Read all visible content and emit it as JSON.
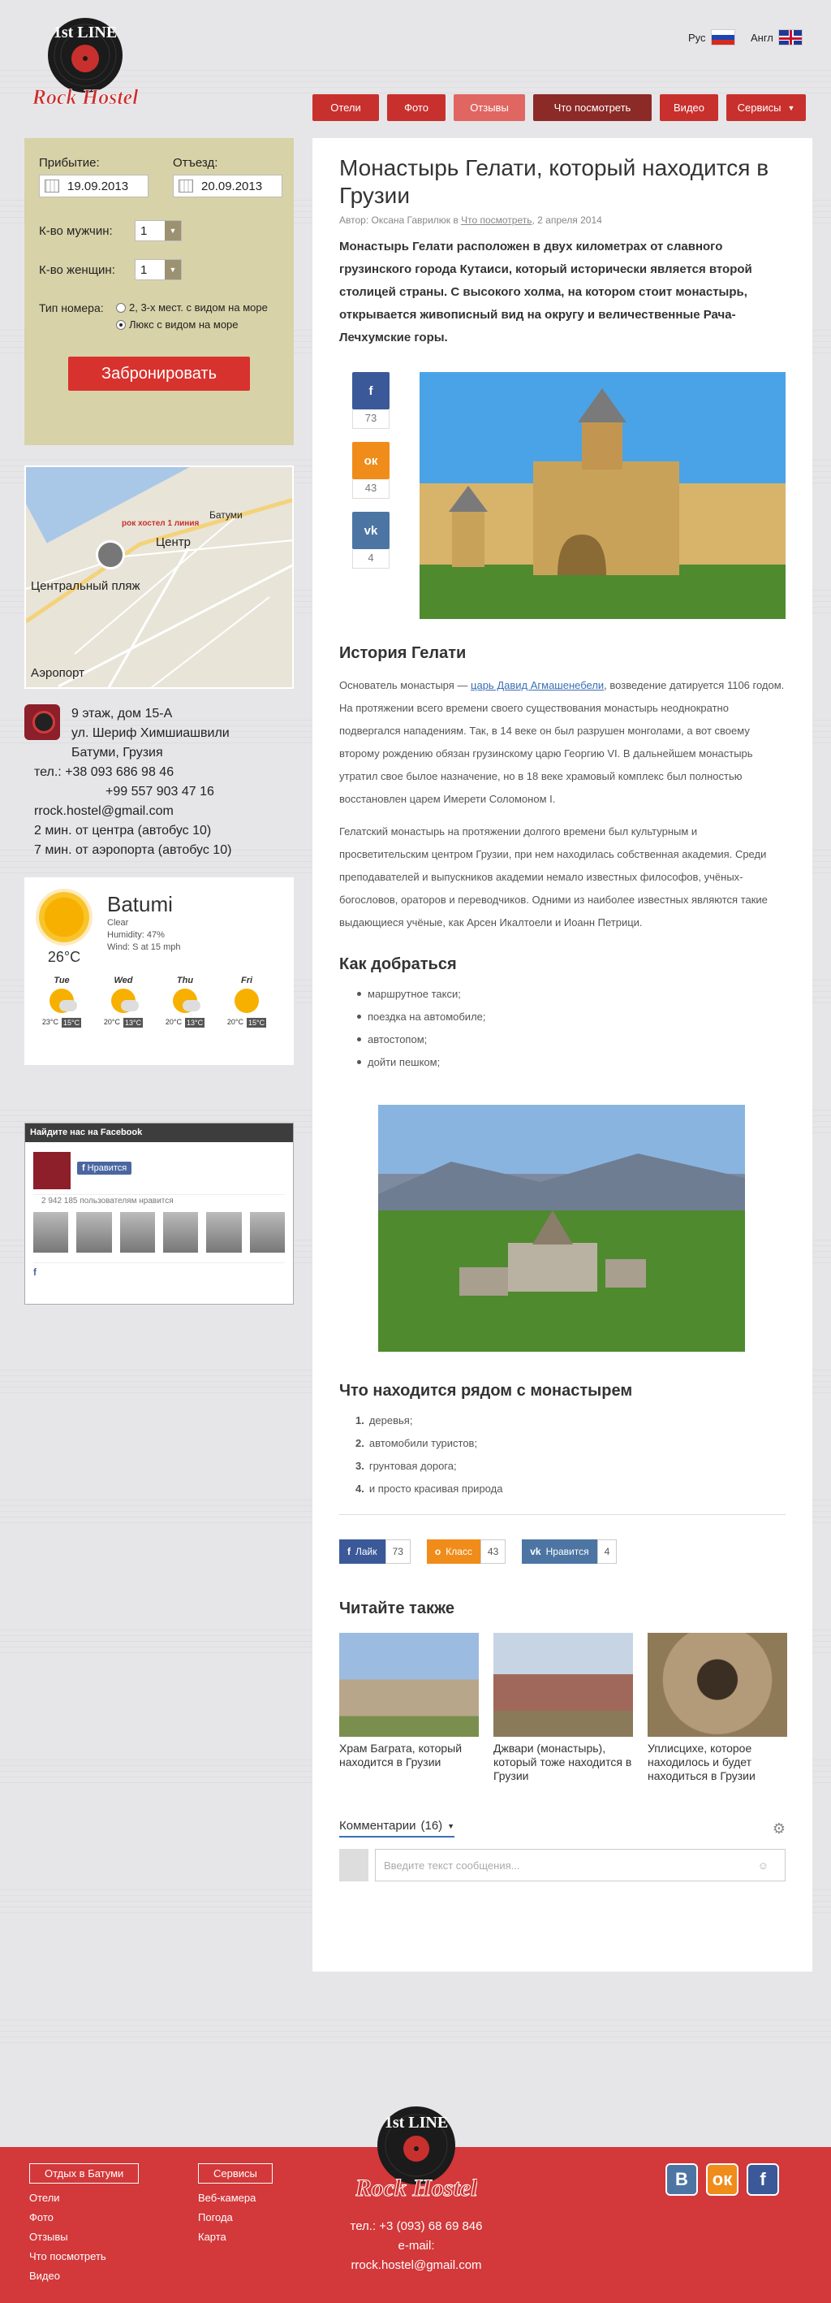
{
  "header": {
    "logo_label": "1st LINE Rock Hostel",
    "lang_ru": "Рус",
    "lang_en": "Англ",
    "nav": [
      "Отели",
      "Фото",
      "Отзывы",
      "Что посмотреть",
      "Видео",
      "Сервисы"
    ]
  },
  "booking": {
    "arrival_label": "Прибытие:",
    "arrival_value": "19.09.2013",
    "departure_label": "Отъезд:",
    "departure_value": "20.09.2013",
    "men_label": "К-во мужчин:",
    "men_value": "1",
    "women_label": "К-во женщин:",
    "women_value": "1",
    "room_label": "Тип номера:",
    "room_opt1": "2, 3-х мест. с видом на море",
    "room_opt2": "Люкс с видом на море",
    "book_button": "Забронировать"
  },
  "map": {
    "label_batumi": "Батуми",
    "label_center": "Центр",
    "label_beach": "Центральный пляж",
    "label_airport": "Аэропорт",
    "label_hostel": "рок хостел 1 линия"
  },
  "address": {
    "lines": [
      "9 этаж, дом 15-А",
      "ул. Шериф Химшиашвили",
      "Батуми, Грузия",
      "тел.: +38 093 686 98 46",
      "+99 557 903 47 16",
      "rrock.hostel@gmail.com",
      "2 мин. от центра (автобус 10)",
      "7 мин. от аэропорта (автобус 10)"
    ]
  },
  "weather": {
    "city": "Batumi",
    "cond": "Clear",
    "humidity": "Humidity: 47%",
    "wind": "Wind: S at 15 mph",
    "temp": "26°C",
    "days": [
      {
        "name": "Tue",
        "hi": "23°C",
        "lo": "15°C"
      },
      {
        "name": "Wed",
        "hi": "20°C",
        "lo": "13°C"
      },
      {
        "name": "Thu",
        "hi": "20°C",
        "lo": "13°C"
      },
      {
        "name": "Fri",
        "hi": "20°C",
        "lo": "15°C"
      }
    ]
  },
  "facebook": {
    "head": "Найдите нас на Facebook",
    "like": "Нравится",
    "count": "2 942 185 пользователям нравится"
  },
  "article": {
    "title": "Монастырь Гелати, который находится в Грузии",
    "meta_prefix": "Автор: Оксана Гаврилюк в ",
    "meta_link": "Что посмотреть",
    "meta_date": ", 2 апреля 2014",
    "lead": "Монастырь Гелати расположен в двух километрах от славного грузинского города Кутаиси, который исторически является второй столицей страны. С высокого холма, на котором стоит монастырь, открывается живописный вид на округу и величественные Рача-Лечхумские горы.",
    "share": [
      {
        "icon": "f",
        "count": "73"
      },
      {
        "icon": "ок",
        "count": "43"
      },
      {
        "icon": "vk",
        "count": "4"
      }
    ],
    "h_history": "История Гелати",
    "p1_a": "Основатель монастыря — ",
    "p1_link": "царь Давид Агмашенебели",
    "p1_b": ", возведение датируется 1106 годом. На протяжении всего времени своего существования монастырь неоднократно подвергался нападениям. Так, в 14 веке он был разрушен монголами, а вот своему второму рождению обязан грузинскому царю Георгию VI. В дальнейшем монастырь утратил свое былое назначение, но в 18 веке храмовый комплекс был полностью восстановлен царем Имерети Соломоном I.",
    "p2": "Гелатский монастырь на протяжении долгого времени был культурным и просветительским центром Грузии, при нем находилась собственная академия. Среди преподавателей и выпускников академии немало известных философов, учёных-богословов, ораторов и переводчиков. Одними из наиболее известных являются такие выдающиеся учёные, как Арсен Икалтоели и Иоанн Петрици.",
    "h_get": "Как добраться",
    "get_list": [
      "маршрутное такси;",
      "поездка на автомобиле;",
      "автостопом;",
      "дойти пешком;"
    ],
    "h_near": "Что находится рядом с монастырем",
    "near_list": [
      "деревья;",
      "автомобили туристов;",
      "грунтовая дорога;",
      "и просто красивая природа"
    ],
    "bottom_share": [
      {
        "label": "Лайк",
        "count": "73"
      },
      {
        "label": "Класс",
        "count": "43"
      },
      {
        "label": "Нравится",
        "count": "4"
      }
    ],
    "h_related": "Читайте также",
    "related": [
      "Храм Баграта, который находится в Грузии",
      "Джвари (монастырь), который тоже находится в Грузии",
      "Уплисцихе, которое находилось и будет находиться в Грузии"
    ],
    "comments_label": "Комментарии",
    "comments_count": "(16)",
    "comment_placeholder": "Введите текст сообщения..."
  },
  "footer": {
    "col1_title": "Отдых в Батуми",
    "col1": [
      "Отели",
      "Фото",
      "Отзывы",
      "Что посмотреть",
      "Видео"
    ],
    "col2_title": "Сервисы",
    "col2": [
      "Веб-камера",
      "Погода",
      "Карта"
    ],
    "phone": "тел.: +3 (093) 68 69 846",
    "email": "e-mail: rrock.hostel@gmail.com",
    "logo_label": "1st LINE Rock Hostel"
  }
}
